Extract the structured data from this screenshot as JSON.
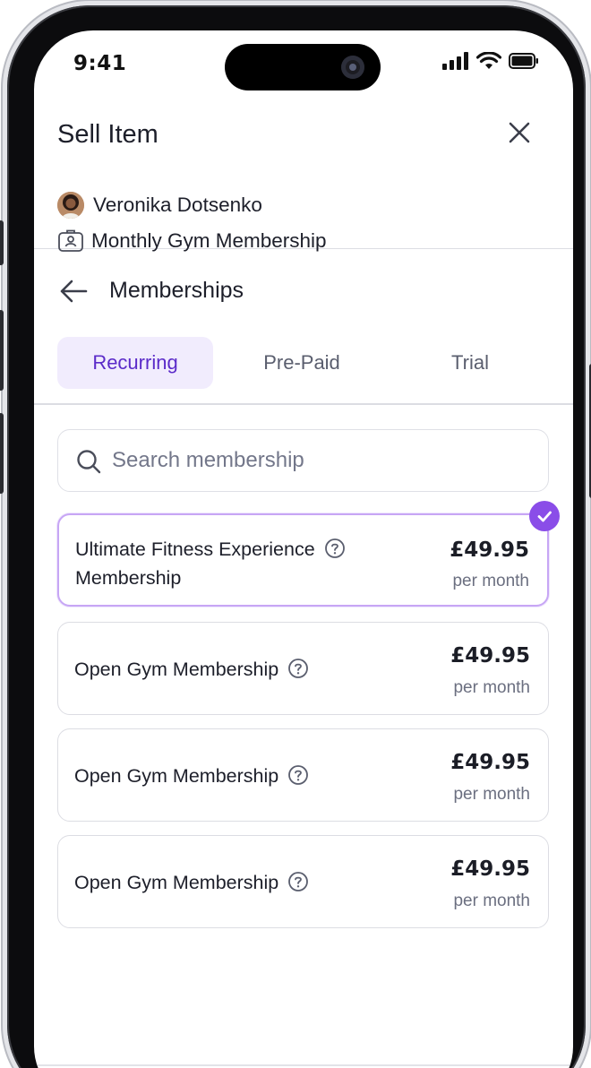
{
  "status_bar": {
    "time": "9:41"
  },
  "header": {
    "title": "Sell Item",
    "customer_name": "Veronika Dotsenko",
    "item_name": "Monthly Gym Membership"
  },
  "section": {
    "title": "Memberships"
  },
  "tabs": [
    {
      "label": "Recurring",
      "active": true
    },
    {
      "label": "Pre-Paid",
      "active": false
    },
    {
      "label": "Trial",
      "active": false
    }
  ],
  "search": {
    "placeholder": "Search membership",
    "value": ""
  },
  "memberships": [
    {
      "name_line1": "Ultimate Fitness Experience",
      "name_line2": "Membership",
      "price": "£49.95",
      "period": "per month",
      "selected": true
    },
    {
      "name_line1": "Open Gym Membership",
      "price": "£49.95",
      "period": "per month",
      "selected": false
    },
    {
      "name_line1": "Open Gym Membership",
      "price": "£49.95",
      "period": "per month",
      "selected": false
    },
    {
      "name_line1": "Open Gym Membership",
      "price": "£49.95",
      "period": "per month",
      "selected": false
    }
  ],
  "colors": {
    "accent": "#5b2bc9",
    "accent_light": "#f1ecfd",
    "selected_border": "#c7a6f5",
    "check_badge": "#8a4de8",
    "border": "#dcdde3"
  },
  "icons": [
    "close-icon",
    "id-card-icon",
    "back-arrow-icon",
    "search-icon",
    "help-circle-icon",
    "check-icon",
    "signal-icon",
    "wifi-icon",
    "battery-icon"
  ]
}
